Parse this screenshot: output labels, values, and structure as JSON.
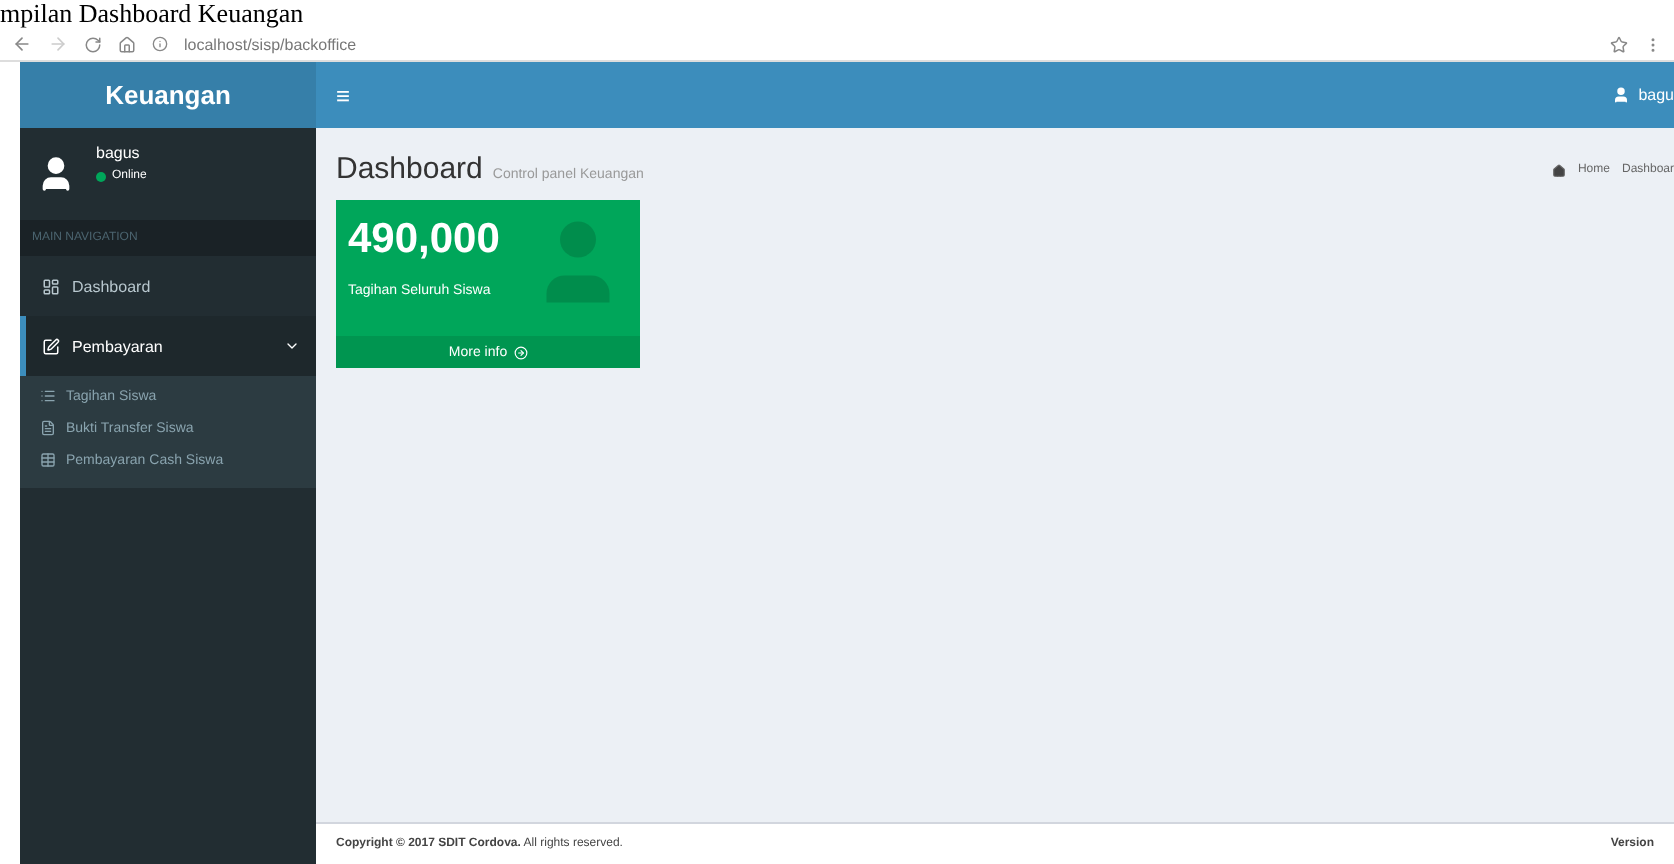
{
  "caption": "mpilan Dashboard Keuangan",
  "browser": {
    "url": "localhost/sisp/backoffice"
  },
  "sidebar": {
    "brand": "Keuangan",
    "user": {
      "name": "bagus",
      "status": "Online",
      "online": true
    },
    "header": "MAIN NAVIGATION",
    "items": [
      {
        "label": "Dashboard",
        "selected": false
      },
      {
        "label": "Pembayaran",
        "selected": true,
        "expanded": true,
        "children": [
          {
            "label": "Tagihan Siswa"
          },
          {
            "label": "Bukti Transfer Siswa"
          },
          {
            "label": "Pembayaran Cash Siswa"
          }
        ]
      }
    ]
  },
  "topbar": {
    "toggle": "≡",
    "user": "bagu"
  },
  "page": {
    "title": "Dashboard",
    "subtitle": "Control panel Keuangan",
    "breadcrumb": [
      "Home",
      "Dashboar"
    ]
  },
  "cards": [
    {
      "value": "490,000",
      "label": "Tagihan Seluruh Siswa",
      "link": "More info",
      "color": "#00a65a"
    }
  ],
  "footer": {
    "text": "**Copyright © 2017 SDIT Cordova.** All rights reserved.",
    "version": "Version"
  }
}
